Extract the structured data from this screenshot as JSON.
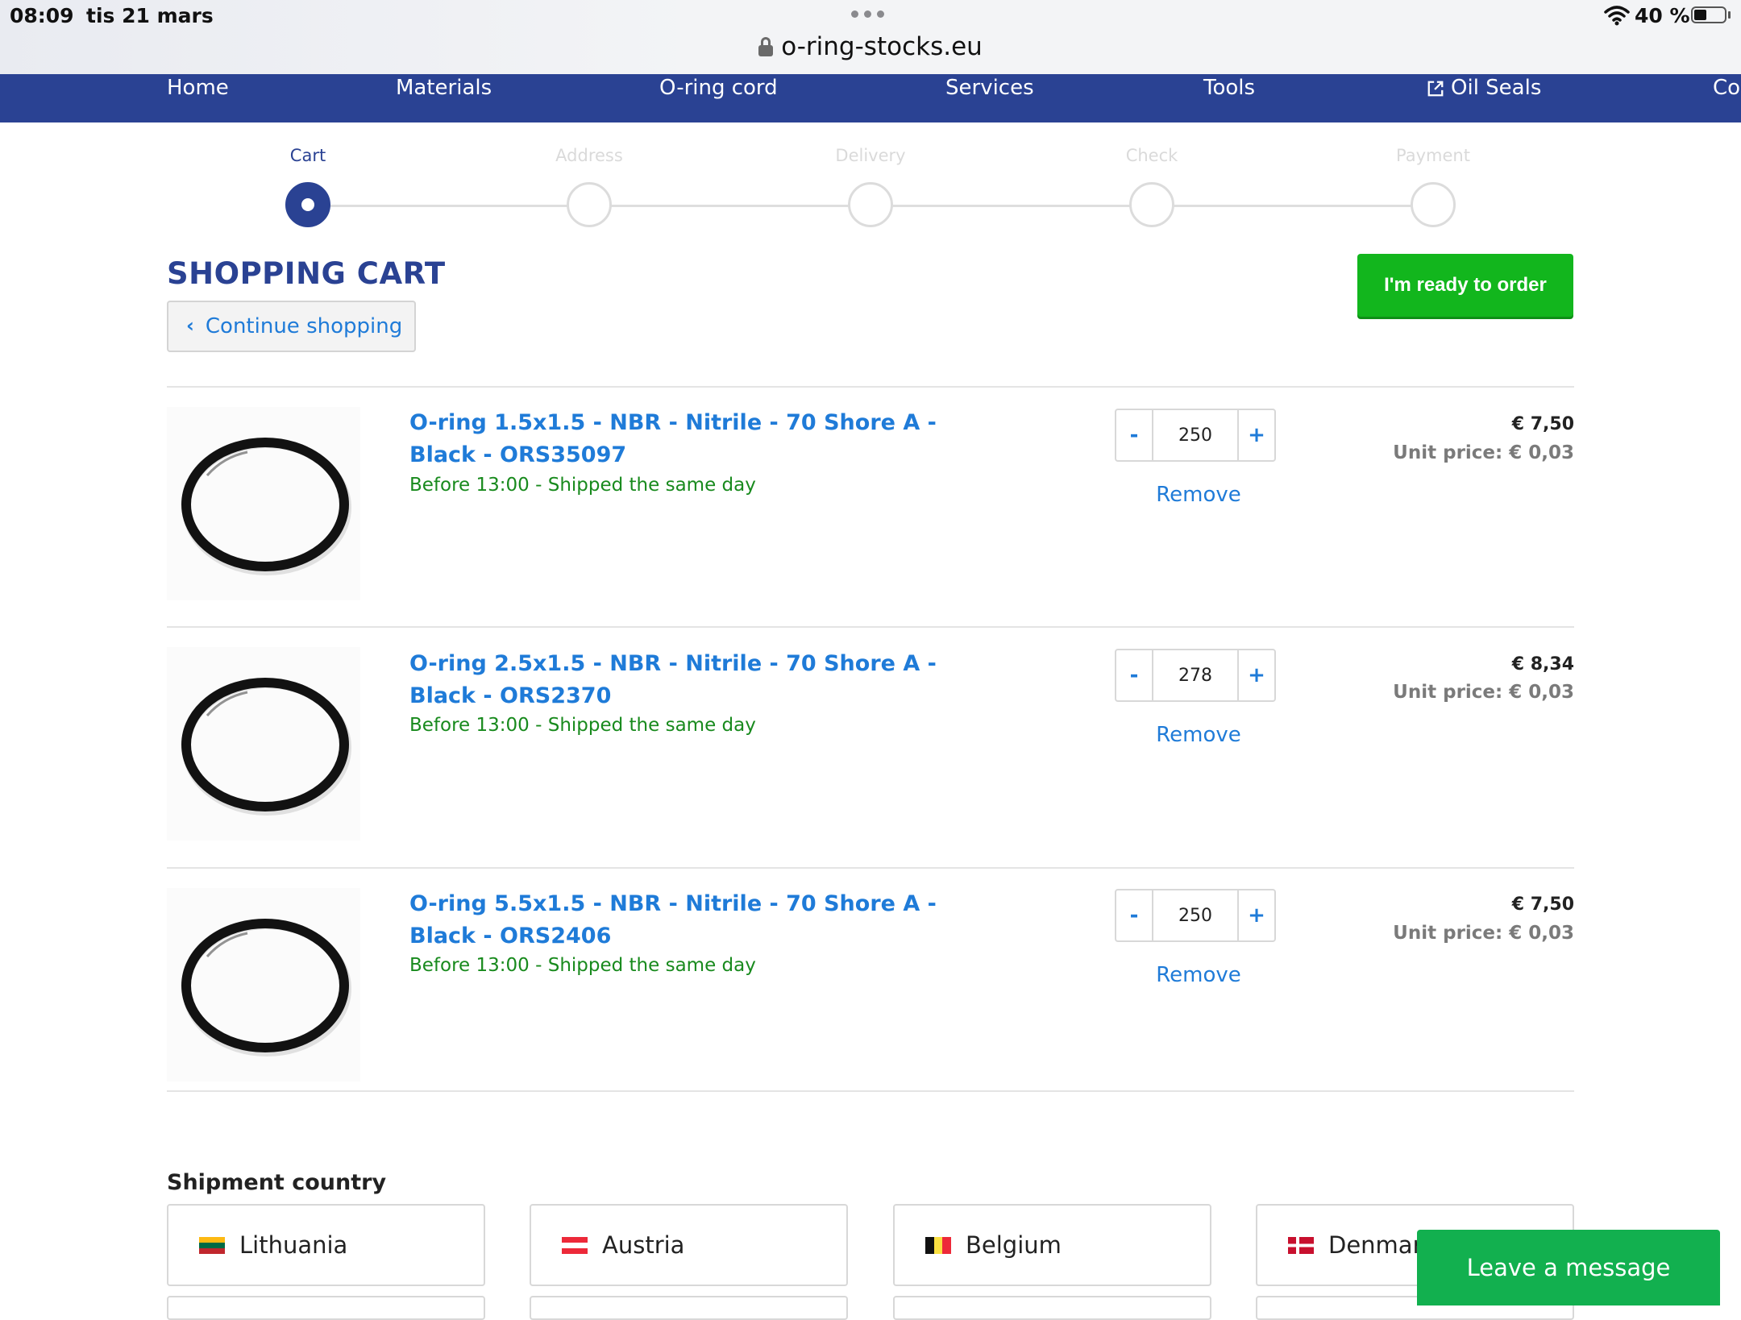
{
  "status_bar": {
    "time": "08:09",
    "date": "tis 21 mars",
    "battery": "40 %"
  },
  "browser": {
    "url": "o-ring-stocks.eu"
  },
  "nav": {
    "items": [
      {
        "label": "Home"
      },
      {
        "label": "Materials"
      },
      {
        "label": "O-ring cord"
      },
      {
        "label": "Services"
      },
      {
        "label": "Tools"
      },
      {
        "label": "Oil Seals"
      },
      {
        "label": "Co"
      }
    ]
  },
  "checkout_steps": [
    {
      "label": "Cart",
      "active": true
    },
    {
      "label": "Address",
      "active": false
    },
    {
      "label": "Delivery",
      "active": false
    },
    {
      "label": "Check",
      "active": false
    },
    {
      "label": "Payment",
      "active": false
    }
  ],
  "cart": {
    "title": "SHOPPING CART",
    "continue_label": "Continue shopping",
    "ready_label": "I'm ready to order",
    "remove_label": "Remove",
    "items": [
      {
        "name": "O-ring 1.5x1.5 - NBR - Nitrile - 70 Shore A - Black - ORS35097",
        "shipping": "Before 13:00 - Shipped the same day",
        "quantity": "250",
        "price": "€ 7,50",
        "unit_price": "Unit price: € 0,03"
      },
      {
        "name": "O-ring 2.5x1.5 - NBR - Nitrile - 70 Shore A - Black - ORS2370",
        "shipping": "Before 13:00 - Shipped the same day",
        "quantity": "278",
        "price": "€ 8,34",
        "unit_price": "Unit price: € 0,03"
      },
      {
        "name": "O-ring 5.5x1.5 - NBR - Nitrile - 70 Shore A - Black - ORS2406",
        "shipping": "Before 13:00 - Shipped the same day",
        "quantity": "250",
        "price": "€ 7,50",
        "unit_price": "Unit price: € 0,03"
      }
    ]
  },
  "shipment": {
    "title": "Shipment country",
    "countries": [
      {
        "name": "Lithuania",
        "flag": "lithuania-flag-icon"
      },
      {
        "name": "Austria",
        "flag": "austria-flag-icon"
      },
      {
        "name": "Belgium",
        "flag": "belgium-flag-icon"
      },
      {
        "name": "Denmark",
        "flag": "denmark-flag-icon"
      }
    ]
  },
  "chat": {
    "label": "Leave a message"
  },
  "colors": {
    "brand_blue": "#2a4293",
    "link_blue": "#1f7bd8",
    "order_green": "#12b61d",
    "ship_green": "#188a1d",
    "chat_green": "#12b04f"
  }
}
